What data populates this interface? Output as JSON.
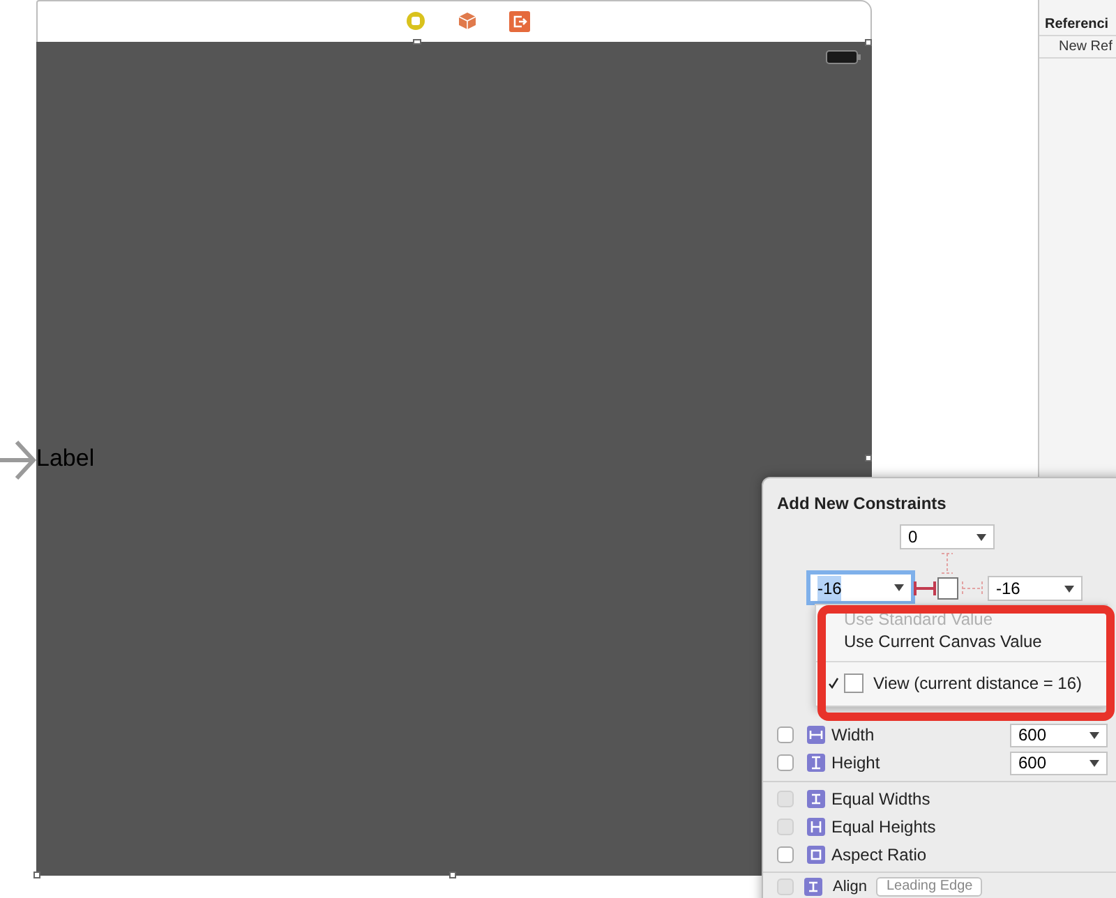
{
  "inspector": {
    "rows": [
      {
        "kind": "header",
        "text": "Referenci"
      },
      {
        "kind": "item",
        "text": "New Ref"
      }
    ]
  },
  "canvas": {
    "label": "Label"
  },
  "popover": {
    "title": "Add New Constraints",
    "top_spacing": {
      "value": "0",
      "focused": false
    },
    "left_spacing": {
      "value": "-16",
      "focused": true
    },
    "right_spacing": {
      "value": "-16",
      "focused": false
    },
    "menu": {
      "items": [
        {
          "kind": "action",
          "label": "Use Standard Value",
          "disabled": true
        },
        {
          "kind": "action",
          "label": "Use Current Canvas Value",
          "disabled": false
        },
        {
          "kind": "view",
          "label": "View (current distance = 16)",
          "checked": true
        }
      ]
    },
    "size_rows": [
      {
        "label": "Width",
        "value": "600",
        "checked": false
      },
      {
        "label": "Height",
        "value": "600",
        "checked": false
      }
    ],
    "relation_rows": [
      {
        "label": "Equal Widths",
        "disabled": true
      },
      {
        "label": "Equal Heights",
        "disabled": true
      },
      {
        "label": "Aspect Ratio",
        "disabled": false
      }
    ],
    "align": {
      "label": "Align",
      "value": "Leading Edge",
      "disabled": true
    }
  }
}
